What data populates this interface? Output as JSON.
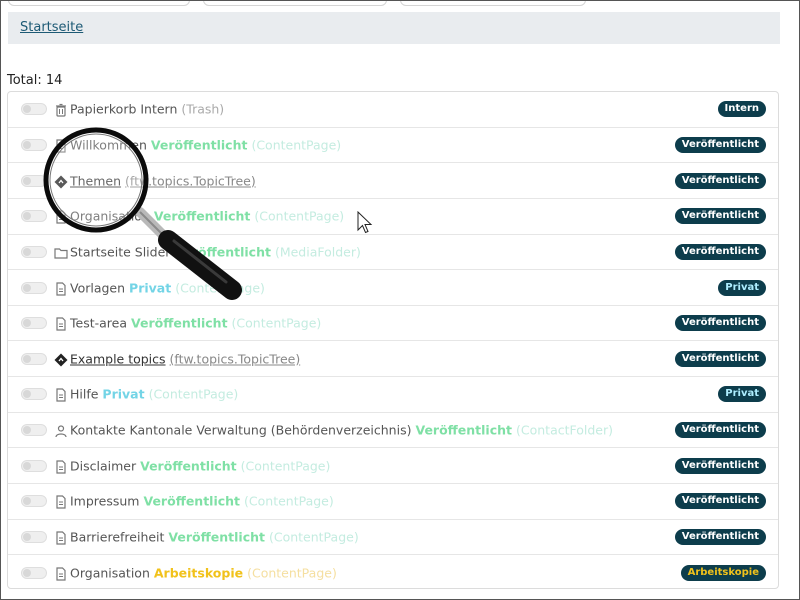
{
  "breadcrumb": {
    "label": "Startseite"
  },
  "total": {
    "label": "Total: 14"
  },
  "rows": [
    {
      "icon": "trash-icon",
      "title": "Papierkorb Intern",
      "status": "",
      "type": "(Trash)",
      "badge": "Intern"
    },
    {
      "icon": "document-icon",
      "title": "Willkommen",
      "status": "Veröffentlicht",
      "type": "(ContentPage)",
      "badge": "Veröffentlicht"
    },
    {
      "icon": "topic-tree-icon",
      "title": "Themen",
      "status": "",
      "type": "(ftw.topics.TopicTree)",
      "badge": "Veröffentlicht"
    },
    {
      "icon": "document-icon",
      "title": "Organisation",
      "status": "Veröffentlicht",
      "type": "(ContentPage)",
      "badge": "Veröffentlicht"
    },
    {
      "icon": "folder-icon",
      "title": "Startseite Slider",
      "status": "Veröffentlicht",
      "type": "(MediaFolder)",
      "badge": "Veröffentlicht"
    },
    {
      "icon": "document-icon",
      "title": "Vorlagen",
      "status": "Privat",
      "type": "(ContentPage)",
      "badge": "Privat"
    },
    {
      "icon": "document-icon",
      "title": "Test-area",
      "status": "Veröffentlicht",
      "type": "(ContentPage)",
      "badge": "Veröffentlicht"
    },
    {
      "icon": "topic-tree-icon",
      "title": "Example topics",
      "status": "",
      "type": "(ftw.topics.TopicTree)",
      "badge": "Veröffentlicht"
    },
    {
      "icon": "document-icon",
      "title": "Hilfe",
      "status": "Privat",
      "type": "(ContentPage)",
      "badge": "Privat"
    },
    {
      "icon": "person-icon",
      "title": "Kontakte Kantonale Verwaltung (Behördenverzeichnis)",
      "status": "Veröffentlicht",
      "type": "(ContactFolder)",
      "badge": "Veröffentlicht"
    },
    {
      "icon": "document-icon",
      "title": "Disclaimer",
      "status": "Veröffentlicht",
      "type": "(ContentPage)",
      "badge": "Veröffentlicht"
    },
    {
      "icon": "document-icon",
      "title": "Impressum",
      "status": "Veröffentlicht",
      "type": "(ContentPage)",
      "badge": "Veröffentlicht"
    },
    {
      "icon": "document-icon",
      "title": "Barrierefreiheit",
      "status": "Veröffentlicht",
      "type": "(ContentPage)",
      "badge": "Veröffentlicht"
    },
    {
      "icon": "document-icon",
      "title": "Organisation",
      "status": "Arbeitskopie",
      "type": "(ContentPage)",
      "badge": "Arbeitskopie"
    }
  ],
  "colors": {
    "badge_bg": "#0d3d4c",
    "published": "#7fe0a5",
    "private": "#73d4e6",
    "working_copy": "#f1c21b",
    "breadcrumb_bg": "#e9ecef"
  }
}
